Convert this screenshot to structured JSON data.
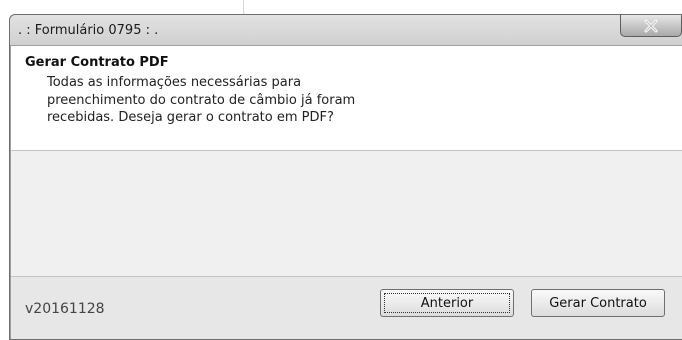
{
  "window": {
    "title": ". : Formulário 0795 : .",
    "close_icon": "close-icon"
  },
  "content": {
    "heading": "Gerar Contrato PDF",
    "message_lines": [
      "Todas as informações necessárias para",
      "preenchimento do contrato de câmbio já foram",
      "recebidas. Deseja gerar o contrato em PDF?"
    ]
  },
  "footer": {
    "version": "v20161128",
    "back_label": "Anterior",
    "generate_label": "Gerar Contrato"
  },
  "colors": {
    "close_button_gradient_top": "#e7e7e7",
    "close_button_gradient_bottom": "#a9a9a9",
    "footer_bg": "#e7e7e7",
    "content_bg": "#ffffff"
  }
}
